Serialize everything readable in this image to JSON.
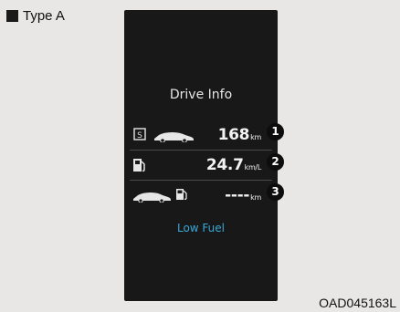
{
  "section_label": "Type A",
  "display": {
    "title": "Drive Info",
    "rows": [
      {
        "icon_left": "S",
        "value": "168",
        "unit": "km",
        "marker": "1"
      },
      {
        "value": "24.7",
        "unit": "km/L",
        "marker": "2"
      },
      {
        "value": "----",
        "unit": "km",
        "marker": "3"
      }
    ],
    "low_fuel_text": "Low Fuel",
    "low_fuel_color": "#3aa7d6"
  },
  "image_code": "OAD045163L",
  "icons": [
    "black-square-icon",
    "segment-s-icon",
    "car-icon",
    "fuel-pump-icon",
    "car-icon",
    "fuel-pump-icon"
  ]
}
